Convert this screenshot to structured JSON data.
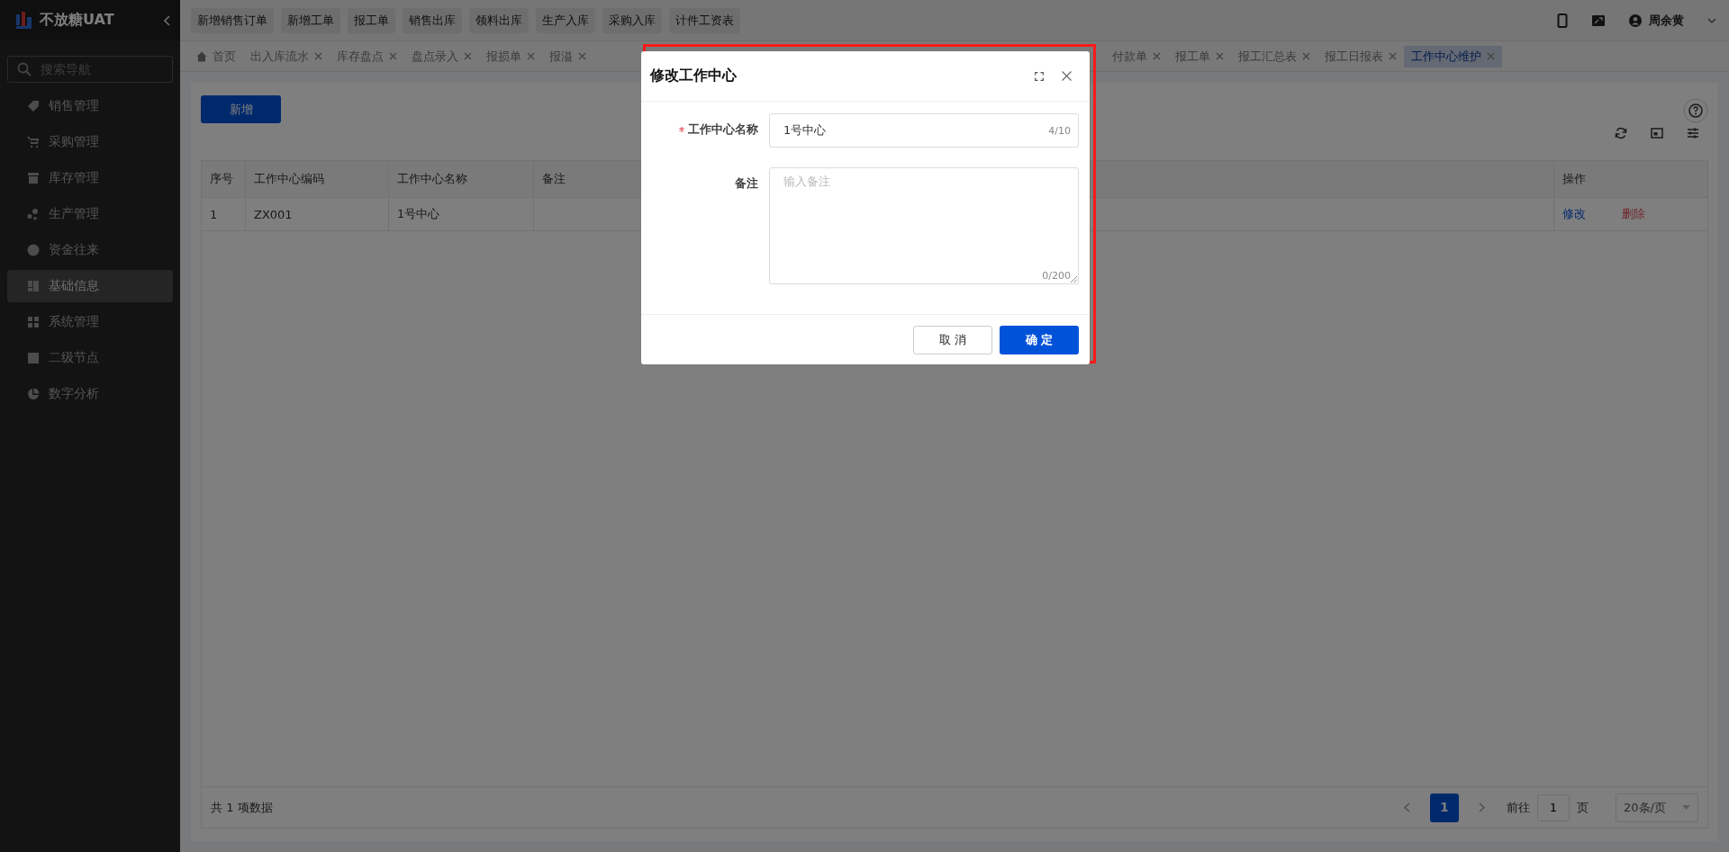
{
  "app": {
    "title": "不放糖UAT"
  },
  "sidebar": {
    "search": {
      "placeholder": "搜索导航"
    },
    "items": [
      {
        "label": "销售管理",
        "selected": false
      },
      {
        "label": "采购管理",
        "selected": false
      },
      {
        "label": "库存管理",
        "selected": false
      },
      {
        "label": "生产管理",
        "selected": false
      },
      {
        "label": "资金往来",
        "selected": false
      },
      {
        "label": "基础信息",
        "selected": true
      },
      {
        "label": "系统管理",
        "selected": false
      },
      {
        "label": "二级节点",
        "selected": false
      },
      {
        "label": "数字分析",
        "selected": false
      }
    ]
  },
  "quick_buttons": [
    "新增销售订单",
    "新增工单",
    "报工单",
    "销售出库",
    "领料出库",
    "生产入库",
    "采购入库",
    "计件工资表"
  ],
  "header": {
    "user": "周余黄"
  },
  "tabs": [
    {
      "label": "首页",
      "kind": "home",
      "selected": false
    },
    {
      "label": "出入库流水",
      "kind": "page",
      "selected": false
    },
    {
      "label": "库存盘点",
      "kind": "page",
      "selected": false
    },
    {
      "label": "盘点录入",
      "kind": "page",
      "selected": false
    },
    {
      "label": "报损单",
      "kind": "page",
      "selected": false
    },
    {
      "label": "报溢",
      "kind": "page",
      "selected": false
    },
    {
      "label": "付款单",
      "kind": "page",
      "selected": false
    },
    {
      "label": "报工单",
      "kind": "page",
      "selected": false
    },
    {
      "label": "报工汇总表",
      "kind": "page",
      "selected": false
    },
    {
      "label": "报工日报表",
      "kind": "page",
      "selected": false
    },
    {
      "label": "工作中心维护",
      "kind": "page",
      "selected": true
    }
  ],
  "toolbar": {
    "add_button": "新增"
  },
  "table": {
    "columns": [
      "序号",
      "工作中心编码",
      "工作中心名称",
      "备注",
      "操作"
    ],
    "rows": [
      {
        "index": "1",
        "code": "ZX001",
        "name": "1号中心",
        "actions": [
          {
            "label": "修改",
            "kind": "edit"
          },
          {
            "label": "删除",
            "kind": "delete"
          }
        ]
      }
    ]
  },
  "pagination": {
    "total": "共 1 项数据",
    "pages": [
      {
        "label": "1",
        "selected": true
      }
    ],
    "goto_label": "前往",
    "goto_value": "1",
    "page_unit": "页",
    "page_size": "20条/页"
  },
  "dialog": {
    "title": "修改工作中心",
    "highlighted": true,
    "fields": [
      {
        "label": "工作中心名称",
        "required": true,
        "kind": "input",
        "value": "1号中心",
        "counter": "4/10"
      },
      {
        "label": "备注",
        "required": false,
        "kind": "textarea",
        "placeholder": "输入备注",
        "counter": "0/200"
      }
    ],
    "buttons": [
      {
        "label": "取 消",
        "kind": "default"
      },
      {
        "label": "确 定",
        "kind": "primary"
      }
    ]
  }
}
